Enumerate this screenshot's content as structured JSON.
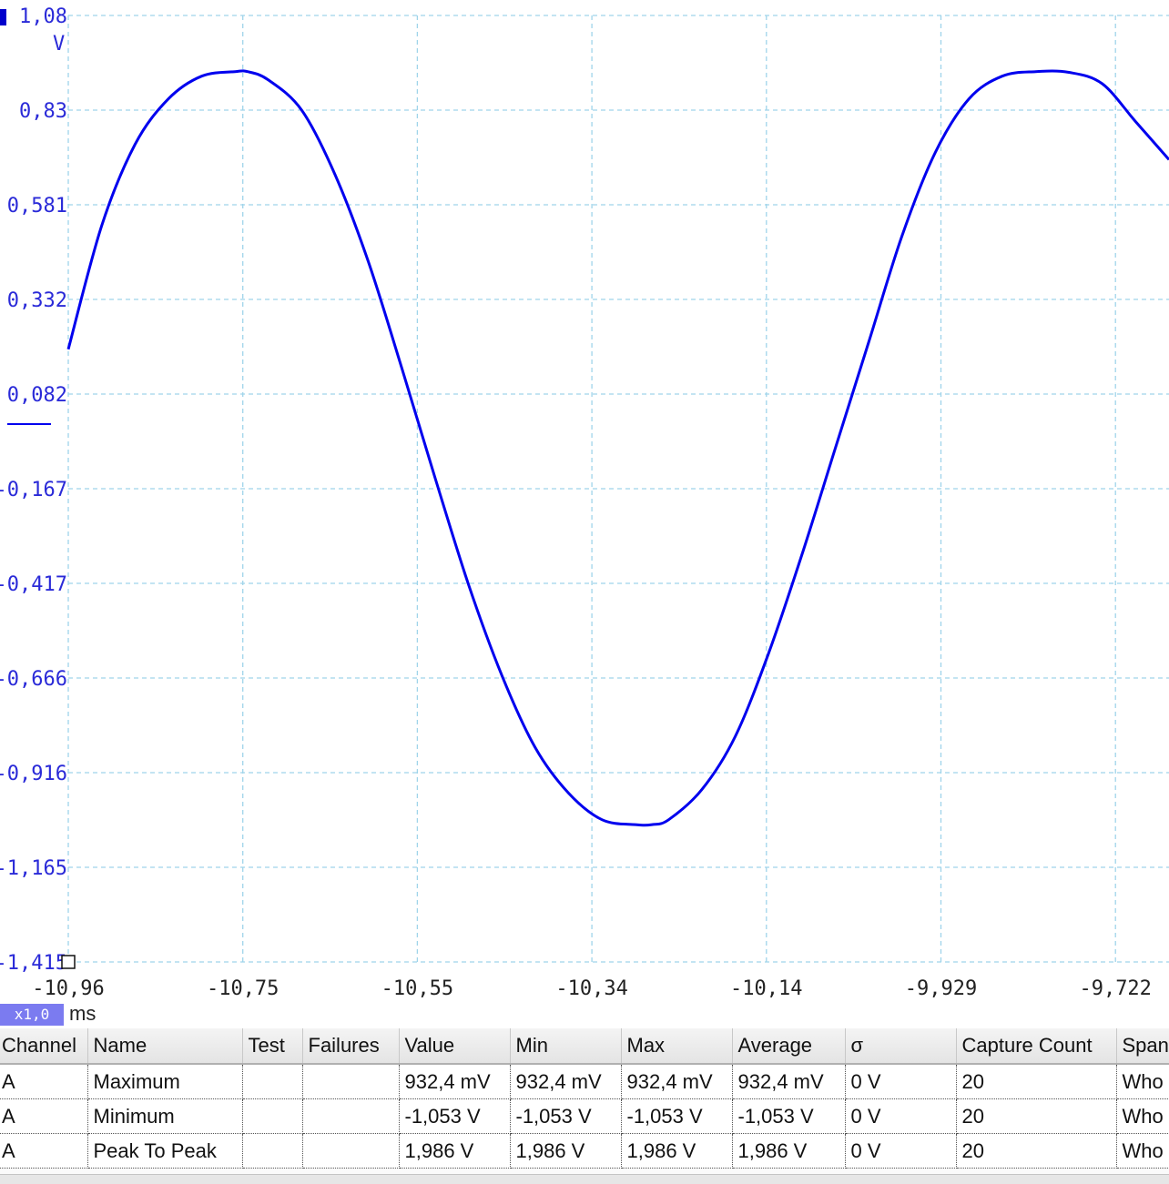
{
  "scope": {
    "y_unit": "V",
    "x_unit": "ms",
    "zoom_label": "x1,0",
    "colors": {
      "trace": "#0000ee",
      "axis_text": "#2a2ad8",
      "grid": "#9fd4ea"
    }
  },
  "chart_data": {
    "type": "line",
    "xlabel": "ms",
    "ylabel": "V",
    "y_ticks": [
      "1,08",
      "0,83",
      "0,581",
      "0,332",
      "0,082",
      "-0,167",
      "-0,417",
      "-0,666",
      "-0,916",
      "-1,165",
      "-1,415"
    ],
    "x_ticks": [
      "-10,96",
      "-10,75",
      "-10,55",
      "-10,34",
      "-10,14",
      "-9,929",
      "-9,722"
    ],
    "xlim": [
      -10.96,
      -9.64
    ],
    "ylim": [
      -1.415,
      1.08
    ],
    "grid": true,
    "series": [
      {
        "x": [
          -10.96,
          -10.92,
          -10.88,
          -10.84,
          -10.8,
          -10.76,
          -10.745,
          -10.72,
          -10.68,
          -10.64,
          -10.6,
          -10.56,
          -10.52,
          -10.48,
          -10.44,
          -10.4,
          -10.36,
          -10.32,
          -10.28,
          -10.26,
          -10.24,
          -10.2,
          -10.16,
          -10.12,
          -10.08,
          -10.04,
          -10.0,
          -9.96,
          -9.92,
          -9.88,
          -9.84,
          -9.8,
          -9.76,
          -9.72,
          -9.68,
          -9.64
        ],
        "y": [
          0.2,
          0.525,
          0.74,
          0.86,
          0.92,
          0.932,
          0.932,
          0.91,
          0.83,
          0.66,
          0.43,
          0.15,
          -0.14,
          -0.42,
          -0.66,
          -0.85,
          -0.97,
          -1.04,
          -1.053,
          -1.053,
          -1.04,
          -0.96,
          -0.82,
          -0.6,
          -0.34,
          -0.06,
          0.22,
          0.5,
          0.72,
          0.86,
          0.92,
          0.932,
          0.93,
          0.9,
          0.8,
          0.7
        ]
      }
    ]
  },
  "measurements": {
    "columns": [
      "Channel",
      "Name",
      "Test",
      "Failures",
      "Value",
      "Min",
      "Max",
      "Average",
      "σ",
      "Capture Count",
      "Span"
    ],
    "rows": [
      [
        "A",
        "Maximum",
        "",
        "",
        "932,4 mV",
        "932,4 mV",
        "932,4 mV",
        "932,4 mV",
        "0 V",
        "20",
        "Who"
      ],
      [
        "A",
        "Minimum",
        "",
        "",
        "-1,053 V",
        "-1,053 V",
        "-1,053 V",
        "-1,053 V",
        "0 V",
        "20",
        "Who"
      ],
      [
        "A",
        "Peak To Peak",
        "",
        "",
        "1,986 V",
        "1,986 V",
        "1,986 V",
        "1,986 V",
        "0 V",
        "20",
        "Who"
      ]
    ]
  }
}
